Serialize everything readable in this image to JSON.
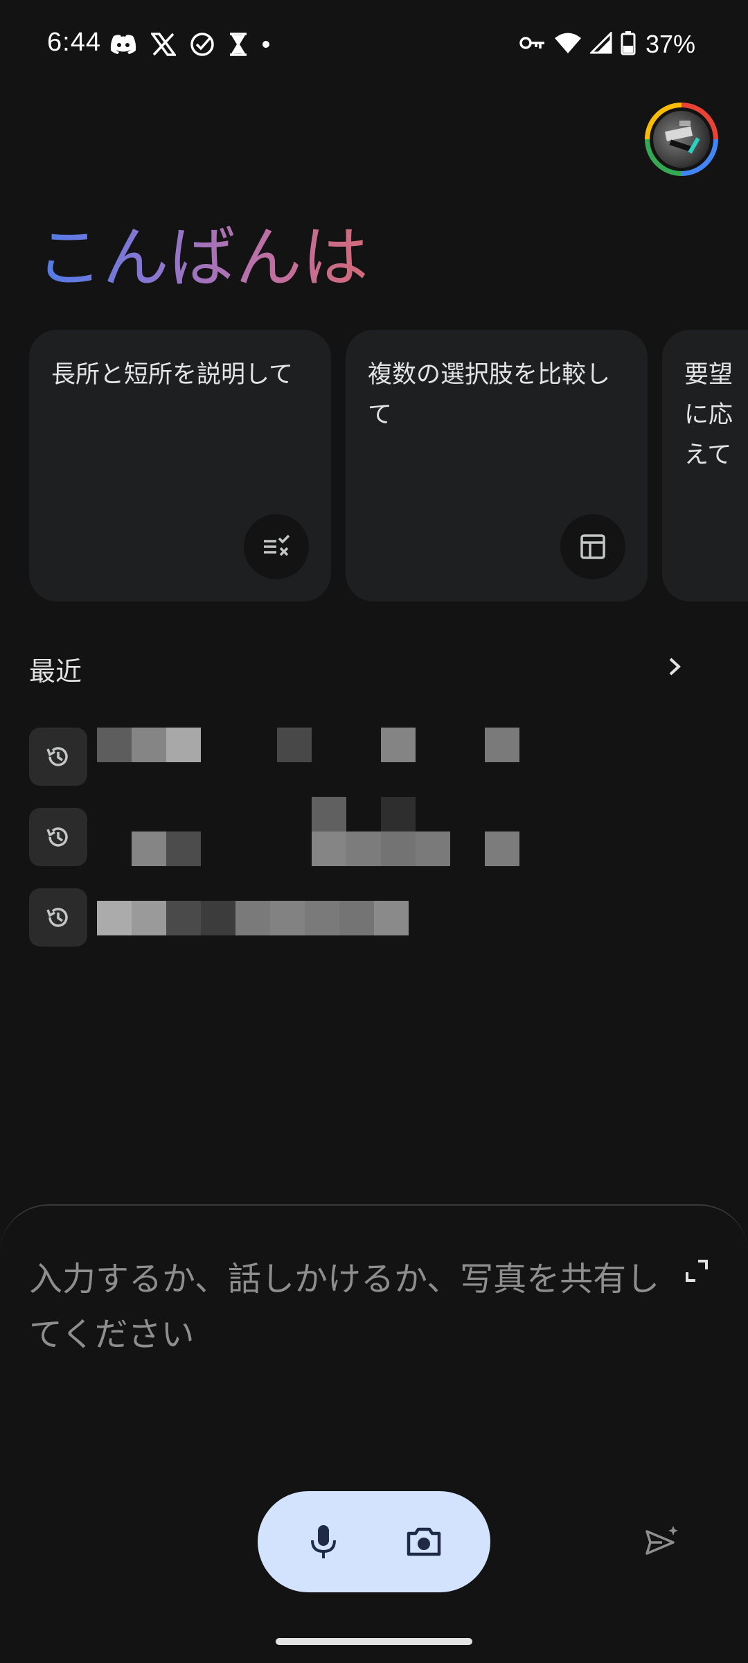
{
  "status_bar": {
    "time": "6:44",
    "battery": "37%",
    "left_icons": [
      "discord-icon",
      "x-icon",
      "check-circle-icon",
      "hourglass-icon",
      "dot-icon"
    ],
    "right_icons": [
      "vpn-key-icon",
      "wifi-icon",
      "signal-icon",
      "battery-icon"
    ]
  },
  "greeting": "こんばんは",
  "suggestions": [
    {
      "text": "長所と短所を説明して",
      "icon": "compare-list-icon"
    },
    {
      "text": "複数の選択肢を比較して",
      "icon": "table-icon"
    },
    {
      "text": "要望に応えて",
      "icon": "chat-icon"
    }
  ],
  "recent": {
    "title": "最近",
    "items": [
      {
        "text": "",
        "icon": "history-icon"
      },
      {
        "text": "",
        "icon": "history-icon"
      },
      {
        "text": "",
        "icon": "history-icon"
      }
    ]
  },
  "input": {
    "placeholder": "入力するか、話しかけるか、写真を共有してください",
    "value": ""
  },
  "colors": {
    "background": "#131314",
    "card": "#1e1f20",
    "pill": "#d3e3fd",
    "gradient_start": "#4f7ce8",
    "gradient_end": "#d26a78"
  }
}
